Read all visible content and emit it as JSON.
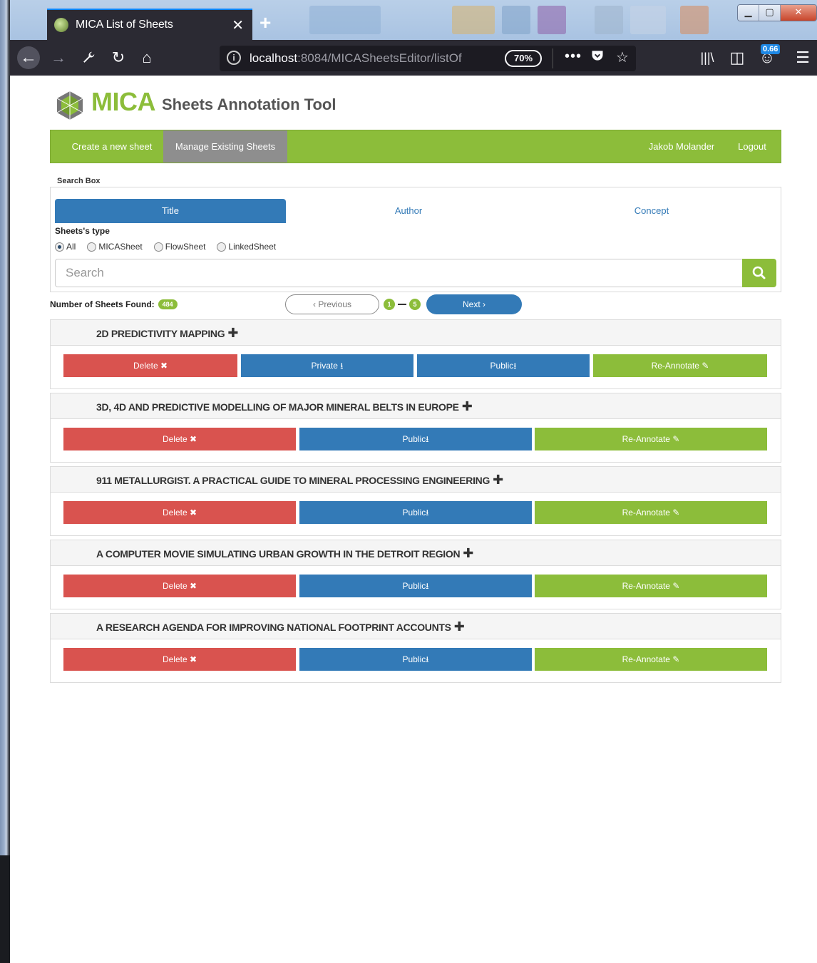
{
  "browser": {
    "tab_title": "MICA List of Sheets",
    "url_host": "localhost",
    "url_path": ":8084/MICASheetsEditor/listOf",
    "zoom": "70%",
    "badge": "0.66"
  },
  "header": {
    "brand": "MICA",
    "subtitle": "Sheets Annotation Tool"
  },
  "menu": {
    "create": "Create a new sheet",
    "manage": "Manage Existing Sheets",
    "user": "Jakob Molander",
    "logout": "Logout"
  },
  "search": {
    "box_label": "Search Box",
    "tabs": [
      "Title",
      "Author",
      "Concept"
    ],
    "type_label": "Sheets's type",
    "types": [
      "All",
      "MICASheet",
      "FlowSheet",
      "LinkedSheet"
    ],
    "selected_type": "All",
    "placeholder": "Search"
  },
  "results": {
    "found_label": "Number of Sheets Found:",
    "found_count": "484",
    "prev_label": "Previous",
    "next_label": "Next",
    "page_from": "1",
    "page_to": "5"
  },
  "sheets": [
    {
      "title": "2D PREDICTIVITY MAPPING",
      "actions": [
        "Delete",
        "Private",
        "Public",
        "Re-Annotate"
      ]
    },
    {
      "title": "3D, 4D AND PREDICTIVE MODELLING OF MAJOR MINERAL BELTS IN EUROPE",
      "actions": [
        "Delete",
        "Public",
        "Re-Annotate"
      ]
    },
    {
      "title": "911 METALLURGIST. A PRACTICAL GUIDE TO MINERAL PROCESSING ENGINEERING",
      "actions": [
        "Delete",
        "Public",
        "Re-Annotate"
      ]
    },
    {
      "title": "A COMPUTER MOVIE SIMULATING URBAN GROWTH IN THE DETROIT REGION",
      "actions": [
        "Delete",
        "Public",
        "Re-Annotate"
      ]
    },
    {
      "title": "A RESEARCH AGENDA FOR IMPROVING NATIONAL FOOTPRINT ACCOUNTS",
      "actions": [
        "Delete",
        "Public",
        "Re-Annotate"
      ]
    }
  ],
  "colors": {
    "green": "#8cbd3a",
    "blue": "#337ab7",
    "red": "#d9534f",
    "gray": "#8e8e8e"
  }
}
